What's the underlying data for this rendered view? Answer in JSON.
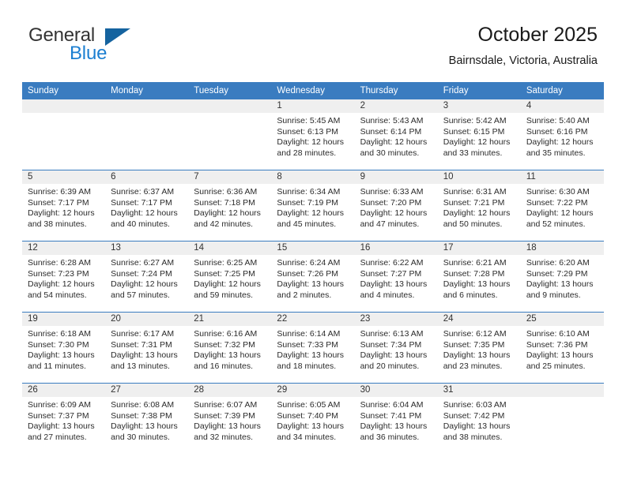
{
  "brand": {
    "name_top": "General",
    "name_bottom": "Blue",
    "accent_color": "#1c7fd1"
  },
  "header": {
    "title": "October 2025",
    "subtitle": "Bairnsdale, Victoria, Australia"
  },
  "calendar": {
    "header_color": "#3a7cc0",
    "banner_color": "#efefef",
    "weekdays": [
      "Sunday",
      "Monday",
      "Tuesday",
      "Wednesday",
      "Thursday",
      "Friday",
      "Saturday"
    ],
    "weeks": [
      [
        {
          "day": "",
          "sunrise": "",
          "sunset": "",
          "daylight": ""
        },
        {
          "day": "",
          "sunrise": "",
          "sunset": "",
          "daylight": ""
        },
        {
          "day": "",
          "sunrise": "",
          "sunset": "",
          "daylight": ""
        },
        {
          "day": "1",
          "sunrise": "Sunrise: 5:45 AM",
          "sunset": "Sunset: 6:13 PM",
          "daylight": "Daylight: 12 hours and 28 minutes."
        },
        {
          "day": "2",
          "sunrise": "Sunrise: 5:43 AM",
          "sunset": "Sunset: 6:14 PM",
          "daylight": "Daylight: 12 hours and 30 minutes."
        },
        {
          "day": "3",
          "sunrise": "Sunrise: 5:42 AM",
          "sunset": "Sunset: 6:15 PM",
          "daylight": "Daylight: 12 hours and 33 minutes."
        },
        {
          "day": "4",
          "sunrise": "Sunrise: 5:40 AM",
          "sunset": "Sunset: 6:16 PM",
          "daylight": "Daylight: 12 hours and 35 minutes."
        }
      ],
      [
        {
          "day": "5",
          "sunrise": "Sunrise: 6:39 AM",
          "sunset": "Sunset: 7:17 PM",
          "daylight": "Daylight: 12 hours and 38 minutes."
        },
        {
          "day": "6",
          "sunrise": "Sunrise: 6:37 AM",
          "sunset": "Sunset: 7:17 PM",
          "daylight": "Daylight: 12 hours and 40 minutes."
        },
        {
          "day": "7",
          "sunrise": "Sunrise: 6:36 AM",
          "sunset": "Sunset: 7:18 PM",
          "daylight": "Daylight: 12 hours and 42 minutes."
        },
        {
          "day": "8",
          "sunrise": "Sunrise: 6:34 AM",
          "sunset": "Sunset: 7:19 PM",
          "daylight": "Daylight: 12 hours and 45 minutes."
        },
        {
          "day": "9",
          "sunrise": "Sunrise: 6:33 AM",
          "sunset": "Sunset: 7:20 PM",
          "daylight": "Daylight: 12 hours and 47 minutes."
        },
        {
          "day": "10",
          "sunrise": "Sunrise: 6:31 AM",
          "sunset": "Sunset: 7:21 PM",
          "daylight": "Daylight: 12 hours and 50 minutes."
        },
        {
          "day": "11",
          "sunrise": "Sunrise: 6:30 AM",
          "sunset": "Sunset: 7:22 PM",
          "daylight": "Daylight: 12 hours and 52 minutes."
        }
      ],
      [
        {
          "day": "12",
          "sunrise": "Sunrise: 6:28 AM",
          "sunset": "Sunset: 7:23 PM",
          "daylight": "Daylight: 12 hours and 54 minutes."
        },
        {
          "day": "13",
          "sunrise": "Sunrise: 6:27 AM",
          "sunset": "Sunset: 7:24 PM",
          "daylight": "Daylight: 12 hours and 57 minutes."
        },
        {
          "day": "14",
          "sunrise": "Sunrise: 6:25 AM",
          "sunset": "Sunset: 7:25 PM",
          "daylight": "Daylight: 12 hours and 59 minutes."
        },
        {
          "day": "15",
          "sunrise": "Sunrise: 6:24 AM",
          "sunset": "Sunset: 7:26 PM",
          "daylight": "Daylight: 13 hours and 2 minutes."
        },
        {
          "day": "16",
          "sunrise": "Sunrise: 6:22 AM",
          "sunset": "Sunset: 7:27 PM",
          "daylight": "Daylight: 13 hours and 4 minutes."
        },
        {
          "day": "17",
          "sunrise": "Sunrise: 6:21 AM",
          "sunset": "Sunset: 7:28 PM",
          "daylight": "Daylight: 13 hours and 6 minutes."
        },
        {
          "day": "18",
          "sunrise": "Sunrise: 6:20 AM",
          "sunset": "Sunset: 7:29 PM",
          "daylight": "Daylight: 13 hours and 9 minutes."
        }
      ],
      [
        {
          "day": "19",
          "sunrise": "Sunrise: 6:18 AM",
          "sunset": "Sunset: 7:30 PM",
          "daylight": "Daylight: 13 hours and 11 minutes."
        },
        {
          "day": "20",
          "sunrise": "Sunrise: 6:17 AM",
          "sunset": "Sunset: 7:31 PM",
          "daylight": "Daylight: 13 hours and 13 minutes."
        },
        {
          "day": "21",
          "sunrise": "Sunrise: 6:16 AM",
          "sunset": "Sunset: 7:32 PM",
          "daylight": "Daylight: 13 hours and 16 minutes."
        },
        {
          "day": "22",
          "sunrise": "Sunrise: 6:14 AM",
          "sunset": "Sunset: 7:33 PM",
          "daylight": "Daylight: 13 hours and 18 minutes."
        },
        {
          "day": "23",
          "sunrise": "Sunrise: 6:13 AM",
          "sunset": "Sunset: 7:34 PM",
          "daylight": "Daylight: 13 hours and 20 minutes."
        },
        {
          "day": "24",
          "sunrise": "Sunrise: 6:12 AM",
          "sunset": "Sunset: 7:35 PM",
          "daylight": "Daylight: 13 hours and 23 minutes."
        },
        {
          "day": "25",
          "sunrise": "Sunrise: 6:10 AM",
          "sunset": "Sunset: 7:36 PM",
          "daylight": "Daylight: 13 hours and 25 minutes."
        }
      ],
      [
        {
          "day": "26",
          "sunrise": "Sunrise: 6:09 AM",
          "sunset": "Sunset: 7:37 PM",
          "daylight": "Daylight: 13 hours and 27 minutes."
        },
        {
          "day": "27",
          "sunrise": "Sunrise: 6:08 AM",
          "sunset": "Sunset: 7:38 PM",
          "daylight": "Daylight: 13 hours and 30 minutes."
        },
        {
          "day": "28",
          "sunrise": "Sunrise: 6:07 AM",
          "sunset": "Sunset: 7:39 PM",
          "daylight": "Daylight: 13 hours and 32 minutes."
        },
        {
          "day": "29",
          "sunrise": "Sunrise: 6:05 AM",
          "sunset": "Sunset: 7:40 PM",
          "daylight": "Daylight: 13 hours and 34 minutes."
        },
        {
          "day": "30",
          "sunrise": "Sunrise: 6:04 AM",
          "sunset": "Sunset: 7:41 PM",
          "daylight": "Daylight: 13 hours and 36 minutes."
        },
        {
          "day": "31",
          "sunrise": "Sunrise: 6:03 AM",
          "sunset": "Sunset: 7:42 PM",
          "daylight": "Daylight: 13 hours and 38 minutes."
        },
        {
          "day": "",
          "sunrise": "",
          "sunset": "",
          "daylight": ""
        }
      ]
    ]
  }
}
